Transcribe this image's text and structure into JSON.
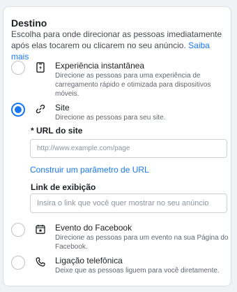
{
  "destination": {
    "title": "Destino",
    "description": "Escolha para onde direcionar as pessoas imediatamente após elas tocarem ou clicarem no seu anúncio.",
    "learn_more": "Saiba mais",
    "options": [
      {
        "title": "Experiência instantânea",
        "subtitle": "Direcione as pessoas para uma experiência de carregamento rápido e otimizada para dispositivos móveis.",
        "icon": "instant-experience-icon",
        "selected": false
      },
      {
        "title": "Site",
        "subtitle": "Direcione as pessoas para seu site.",
        "icon": "link-icon",
        "selected": true
      },
      {
        "title": "Evento do Facebook",
        "subtitle": "Direcione as pessoas para um evento na sua Página do Facebook.",
        "icon": "calendar-star-icon",
        "selected": false
      },
      {
        "title": "Ligação telefônica",
        "subtitle": "Deixe que as pessoas liguem para você diretamente.",
        "icon": "phone-icon",
        "selected": false
      }
    ]
  },
  "site": {
    "url_label": "* URL do site",
    "url_placeholder": "http://www.example.com/page",
    "url_value": "",
    "build_param_link": "Construir um parâmetro de URL",
    "display_link_label": "Link de exibição",
    "display_link_placeholder": "Insira o link que você quer mostrar no seu anúncio",
    "display_link_value": ""
  },
  "colors": {
    "accent": "#1877f2",
    "text": "#1c1e21",
    "secondary_text": "#606770",
    "border": "#ccd0d5",
    "background": "#f0f2f5"
  }
}
